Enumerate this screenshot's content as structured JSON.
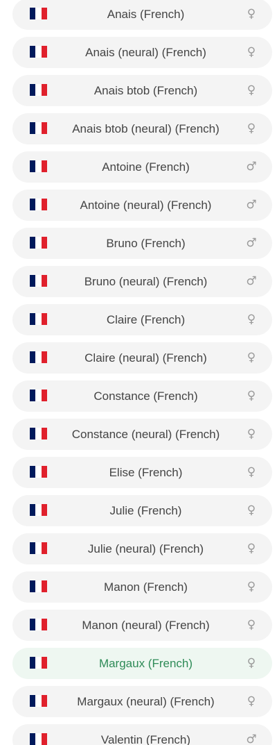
{
  "voices": [
    {
      "name": "Anais (French)",
      "gender": "♀",
      "selected": false
    },
    {
      "name": "Anais (neural) (French)",
      "gender": "♀",
      "selected": false
    },
    {
      "name": "Anais btob (French)",
      "gender": "♀",
      "selected": false
    },
    {
      "name": "Anais btob (neural) (French)",
      "gender": "♀",
      "selected": false
    },
    {
      "name": "Antoine (French)",
      "gender": "♂",
      "selected": false
    },
    {
      "name": "Antoine (neural) (French)",
      "gender": "♂",
      "selected": false
    },
    {
      "name": "Bruno (French)",
      "gender": "♂",
      "selected": false
    },
    {
      "name": "Bruno (neural) (French)",
      "gender": "♂",
      "selected": false
    },
    {
      "name": "Claire (French)",
      "gender": "♀",
      "selected": false
    },
    {
      "name": "Claire (neural) (French)",
      "gender": "♀",
      "selected": false
    },
    {
      "name": "Constance (French)",
      "gender": "♀",
      "selected": false
    },
    {
      "name": "Constance (neural) (French)",
      "gender": "♀",
      "selected": false
    },
    {
      "name": "Elise (French)",
      "gender": "♀",
      "selected": false
    },
    {
      "name": "Julie (French)",
      "gender": "♀",
      "selected": false
    },
    {
      "name": "Julie (neural) (French)",
      "gender": "♀",
      "selected": false
    },
    {
      "name": "Manon (French)",
      "gender": "♀",
      "selected": false
    },
    {
      "name": "Manon (neural) (French)",
      "gender": "♀",
      "selected": false
    },
    {
      "name": "Margaux (French)",
      "gender": "♀",
      "selected": true
    },
    {
      "name": "Margaux (neural) (French)",
      "gender": "♀",
      "selected": false
    },
    {
      "name": "Valentin (French)",
      "gender": "♂",
      "selected": false
    }
  ],
  "flag_icon": "france-flag-icon",
  "colors": {
    "row_background": "#f4f4f4",
    "selected_background": "#eef7f1",
    "selected_text": "#2e8b57",
    "text": "#444444",
    "gender_symbol": "#9a9a9a"
  }
}
